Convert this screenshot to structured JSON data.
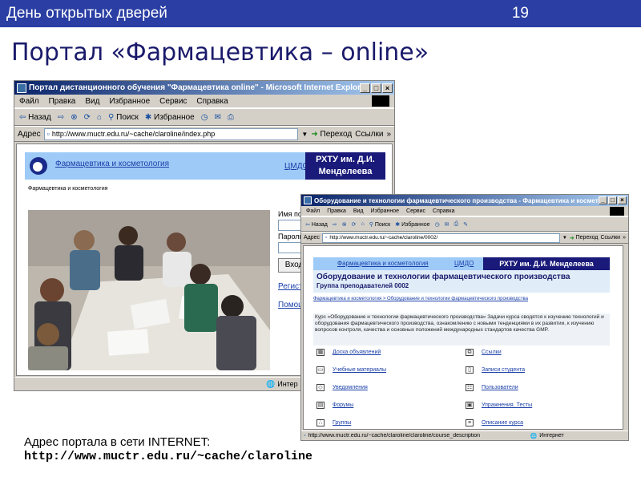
{
  "slide": {
    "header_left": "День открытых дверей",
    "header_right": "19",
    "title": "Портал «Фармацевтика – online»",
    "caption": "Адрес портала в сети INTERNET:",
    "caption_url": "http://www.muctr.edu.ru/~cache/claroline"
  },
  "colors": {
    "header_bar": "#2a3ea3",
    "site_nav": "#9ecaf7",
    "site_brand": "#1a1a7a",
    "link": "#1a3fa8"
  },
  "window1": {
    "title": "Портал дистанционного обучения \"Фармацевтика online\" - Microsoft Internet Explorer",
    "controls": [
      "_",
      "□",
      "×"
    ],
    "menu": [
      "Файл",
      "Правка",
      "Вид",
      "Избранное",
      "Сервис",
      "Справка"
    ],
    "toolbar": {
      "back": "Назад",
      "search": "Поиск",
      "favorites": "Избранное"
    },
    "address": {
      "label": "Адрес",
      "url": "http://www.muctr.edu.ru/~cache/claroline/index.php",
      "go": "Переход",
      "links": "Ссылки"
    },
    "site": {
      "header_link": "Фармацевтика и косметология",
      "cmdo": "ЦМДО",
      "university": "РХТУ им. Д.И. Менделеева",
      "subheading": "Фармацевтика и косметология",
      "login_label": "Имя пол",
      "password_label": "Пароль",
      "login_button": "Вход",
      "register_link": "Регист",
      "help_link": "Помощ"
    },
    "status": "Интер"
  },
  "window2": {
    "title": "Оборудование и технологии фармацевтического производства - Фармацевтика и косметоло...",
    "controls": [
      "_",
      "□",
      "×"
    ],
    "menu": [
      "Файл",
      "Правка",
      "Вид",
      "Избранное",
      "Сервис",
      "Справка"
    ],
    "toolbar": {
      "back": "Назад",
      "search": "Поиск",
      "favorites": "Избранное"
    },
    "address": {
      "label": "Адрес",
      "url": "http://www.muctr.edu.ru/~cache/claroline/0002/",
      "go": "Переход",
      "links": "Ссылки"
    },
    "site": {
      "nav_link": "Фармацевтика и косметология",
      "cmdo": "ЦМДО",
      "university": "РХТУ им. Д.И. Менделеева",
      "course_title": "Оборудование и технологии фармацевтического производства",
      "group": "Группа преподавателей 0002",
      "breadcrumb": "Фармацевтика и косметология > Оборудование и технологии фармацевтического производства",
      "description": "Курс «Оборудование и технологии фармацевтического производства» Задачи курса сводятся к изучению технологий и оборудования фармацевтического производства, ознакомлению с новыми тенденциями в их развитии, к изучению вопросов контроля, качества и основных положений международных стандартов качества GMP.",
      "links_left": [
        {
          "label": "Доска объявлений",
          "icon": "grid-icon"
        },
        {
          "label": "Учебные материалы",
          "icon": "folder-icon"
        },
        {
          "label": "Уведомления",
          "icon": "note-icon"
        },
        {
          "label": "Форумы",
          "icon": "forum-icon"
        },
        {
          "label": "Группы",
          "icon": "group-icon"
        }
      ],
      "links_right": [
        {
          "label": "Ссылки",
          "icon": "link-icon"
        },
        {
          "label": "Записи студента",
          "icon": "notebook-icon"
        },
        {
          "label": "Пользователи",
          "icon": "users-icon"
        },
        {
          "label": "Упражнения. Тесты",
          "icon": "test-icon"
        },
        {
          "label": "Описание курса",
          "icon": "description-icon"
        }
      ]
    },
    "status_url": "http://www.muctr.edu.ru/~cache/claroline/claroline/course_description",
    "status": "Интернет"
  }
}
